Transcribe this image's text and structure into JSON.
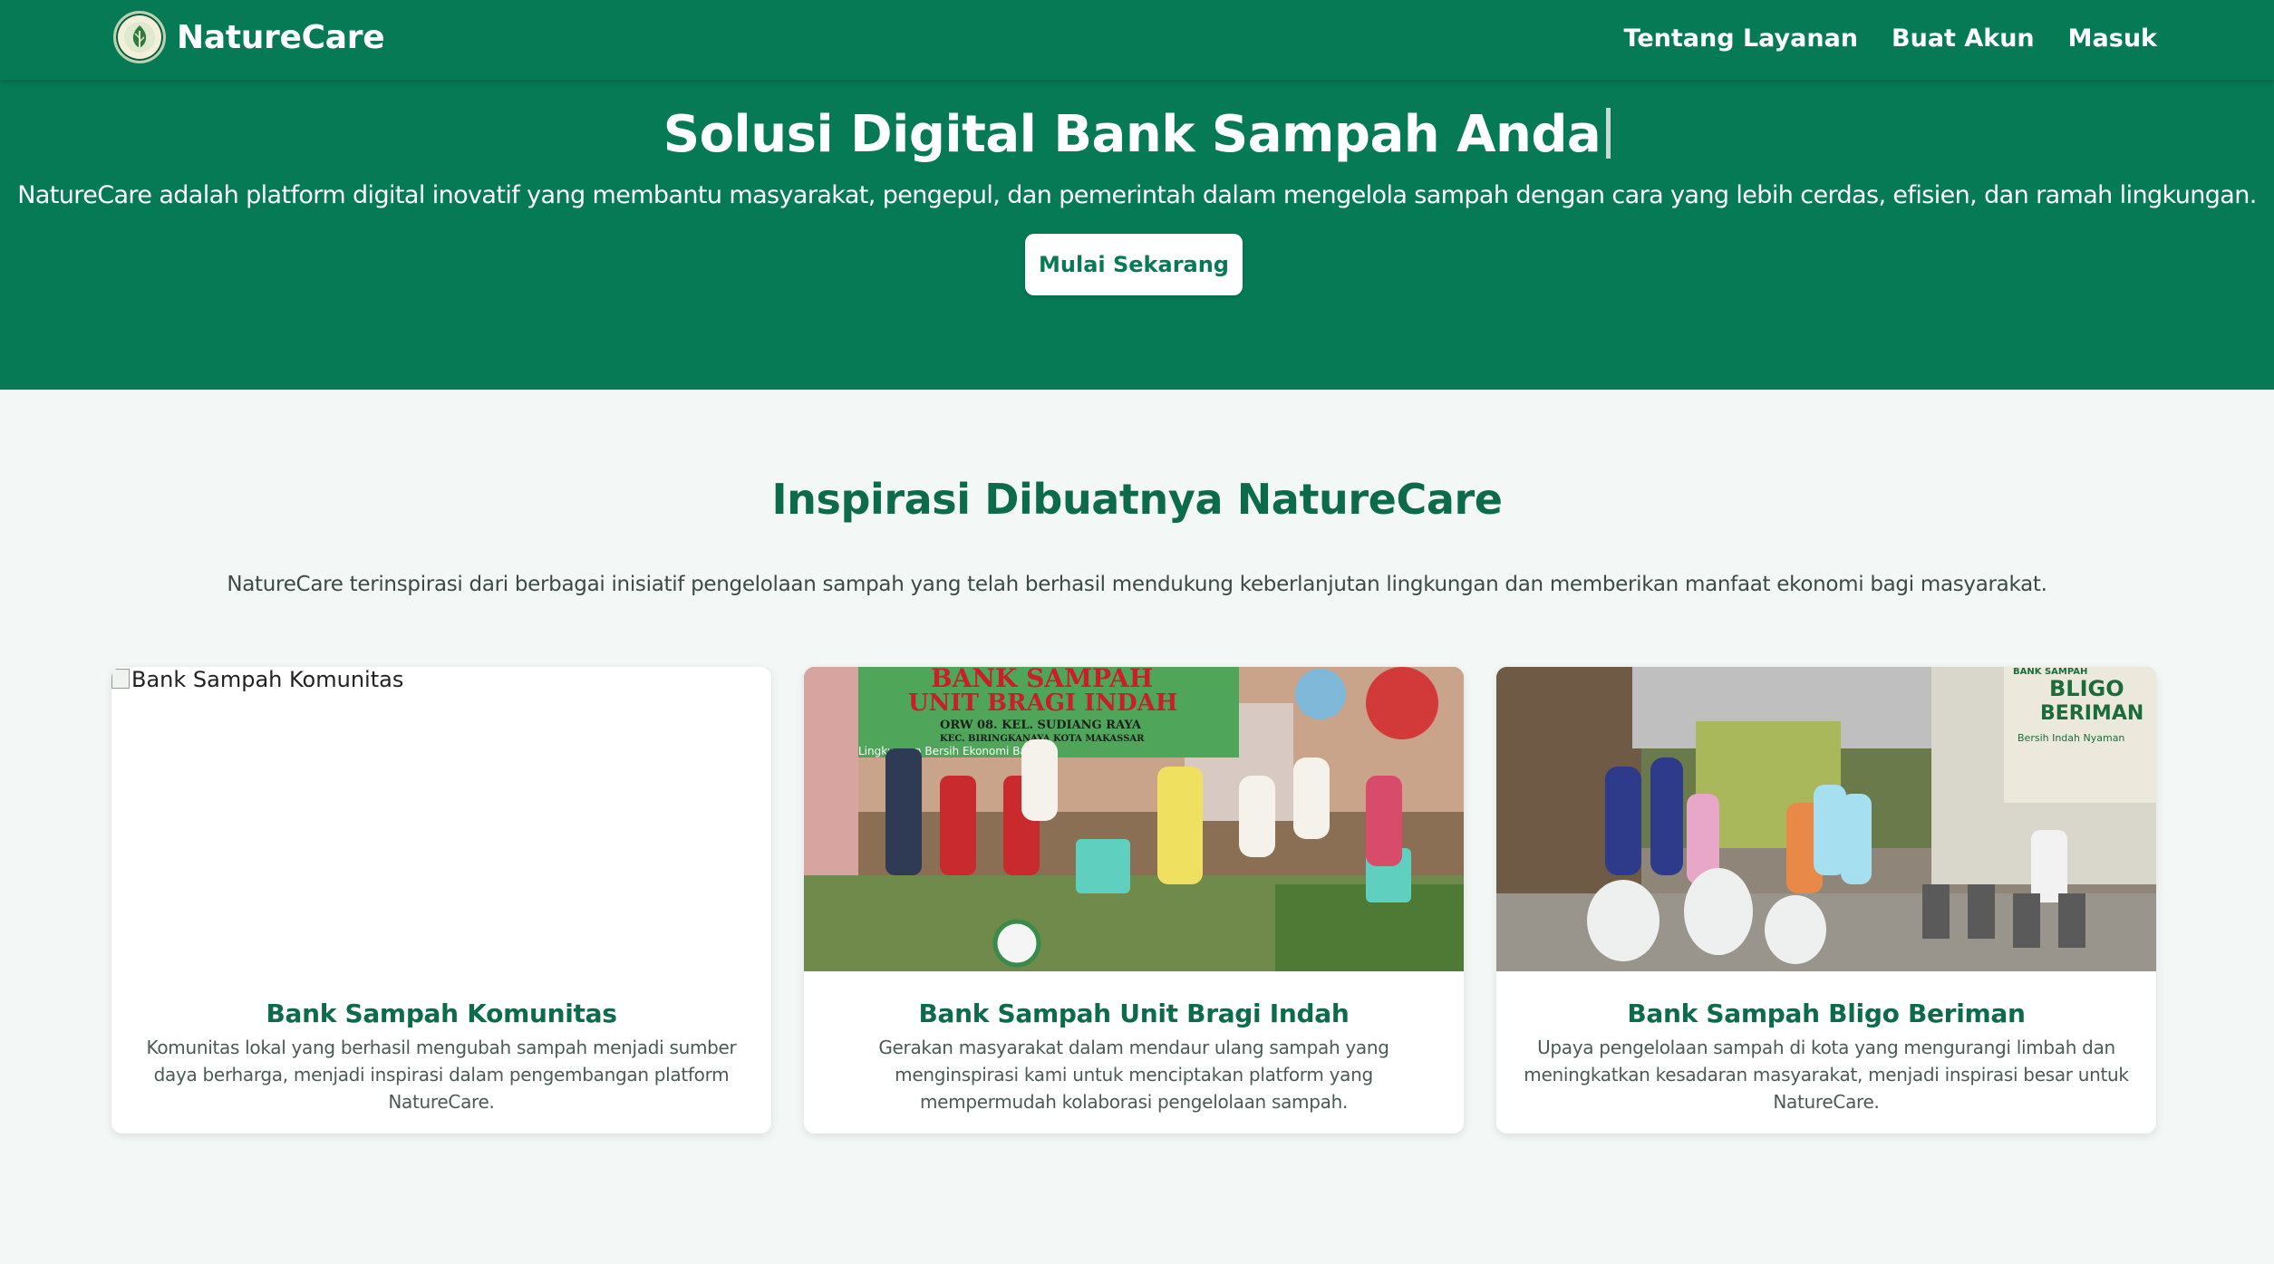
{
  "navbar": {
    "brand": "NatureCare",
    "links": [
      "Tentang Layanan",
      "Buat Akun",
      "Masuk"
    ]
  },
  "hero": {
    "title": "Solusi Digital Bank Sampah Anda",
    "description": "NatureCare adalah platform digital inovatif yang membantu masyarakat, pengepul, dan pemerintah dalam mengelola sampah dengan cara yang lebih cerdas, efisien, dan ramah lingkungan.",
    "button": "Mulai Sekarang"
  },
  "inspiration": {
    "title": "Inspirasi Dibuatnya NatureCare",
    "description": "NatureCare terinspirasi dari berbagai inisiatif pengelolaan sampah yang telah berhasil mendukung keberlanjutan lingkungan dan memberikan manfaat ekonomi bagi masyarakat.",
    "cards": [
      {
        "image_alt": "Bank Sampah Komunitas",
        "title": "Bank Sampah Komunitas",
        "text": "Komunitas lokal yang berhasil mengubah sampah menjadi sumber daya berharga, menjadi inspirasi dalam pengembangan platform NatureCare."
      },
      {
        "title": "Bank Sampah Unit Bragi Indah",
        "text": "Gerakan masyarakat dalam mendaur ulang sampah yang menginspirasi kami untuk menciptakan platform yang mempermudah kolaborasi pengelolaan sampah.",
        "banner_lines": [
          "BANK SAMPAH",
          "UNIT BRAGI INDAH",
          "ORW 08. KEL. SUDIANG RAYA",
          "KEC. BIRINGKANAYA KOTA MAKASSAR",
          "Lingkungan Bersih Ekonomi Bangkit"
        ]
      },
      {
        "title": "Bank Sampah Bligo Beriman",
        "text": "Upaya pengelolaan sampah di kota yang mengurangi limbah dan meningkatkan kesadaran masyarakat, menjadi inspirasi besar untuk NatureCare.",
        "sign_lines": [
          "BANK SAMPAH",
          "BLIGO",
          "BERIMAN",
          "Bersih Indah Nyaman"
        ]
      }
    ]
  },
  "colors": {
    "primary": "#067a55",
    "heading": "#0b6b4a",
    "background": "#f3f7f5"
  }
}
